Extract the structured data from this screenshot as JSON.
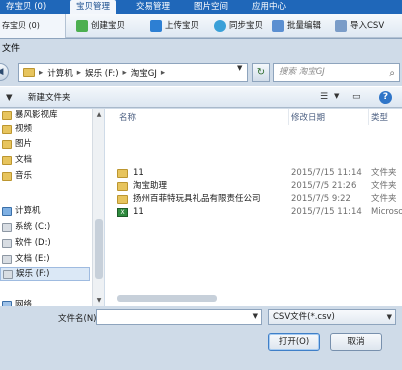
{
  "app_tabs": [
    "存宝贝 (0)",
    "宝贝管理",
    "交易管理",
    "图片空间",
    "应用中心"
  ],
  "app_toolbar": {
    "strip_label": "存宝贝 (0)",
    "create_label": "创建宝贝",
    "upload_label": "上传宝贝",
    "sync_label": "同步宝贝",
    "batch_edit_label": "批量编辑",
    "import_csv_label": "导入CSV"
  },
  "dialog": {
    "title": "文件",
    "breadcrumb": [
      "计算机",
      "娱乐 (F:)",
      "淘宝GJ"
    ],
    "search_placeholder": "搜索 淘宝GJ",
    "new_folder_label": "新建文件夹",
    "help_icon": "?"
  },
  "nav_pane": {
    "items": [
      {
        "label": "暴风影视库",
        "icon": "folder-icon"
      },
      {
        "label": "视频",
        "icon": "folder-icon"
      },
      {
        "label": "图片",
        "icon": "folder-icon"
      },
      {
        "label": "文档",
        "icon": "folder-icon"
      },
      {
        "label": "音乐",
        "icon": "folder-icon"
      },
      {
        "label": "计算机",
        "icon": "computer-icon"
      },
      {
        "label": "系统 (C:)",
        "icon": "drive-icon"
      },
      {
        "label": "软件 (D:)",
        "icon": "drive-icon"
      },
      {
        "label": "文档 (E:)",
        "icon": "drive-icon"
      },
      {
        "label": "娱乐 (F:)",
        "icon": "drive-icon"
      },
      {
        "label": "网络",
        "icon": "network-icon"
      }
    ]
  },
  "file_list": {
    "columns": [
      "名称",
      "修改日期",
      "类型"
    ],
    "rows": [
      {
        "name": "11",
        "date": "2015/7/15 11:14",
        "type": "文件夹",
        "icon": "folder-icon"
      },
      {
        "name": "淘宝助理",
        "date": "2015/7/5 21:26",
        "type": "文件夹",
        "icon": "folder-icon"
      },
      {
        "name": "扬州百菲特玩具礼品有限责任公司",
        "date": "2015/7/5 9:22",
        "type": "文件夹",
        "icon": "folder-icon"
      },
      {
        "name": "11",
        "date": "2015/7/15 11:14",
        "type": "Microso",
        "icon": "excel-icon"
      }
    ]
  },
  "bottom": {
    "filename_label": "文件名(N):",
    "filename_value": "",
    "filter_value": "CSV文件(*.csv)",
    "open_label": "打开(O)",
    "cancel_label": "取消"
  }
}
